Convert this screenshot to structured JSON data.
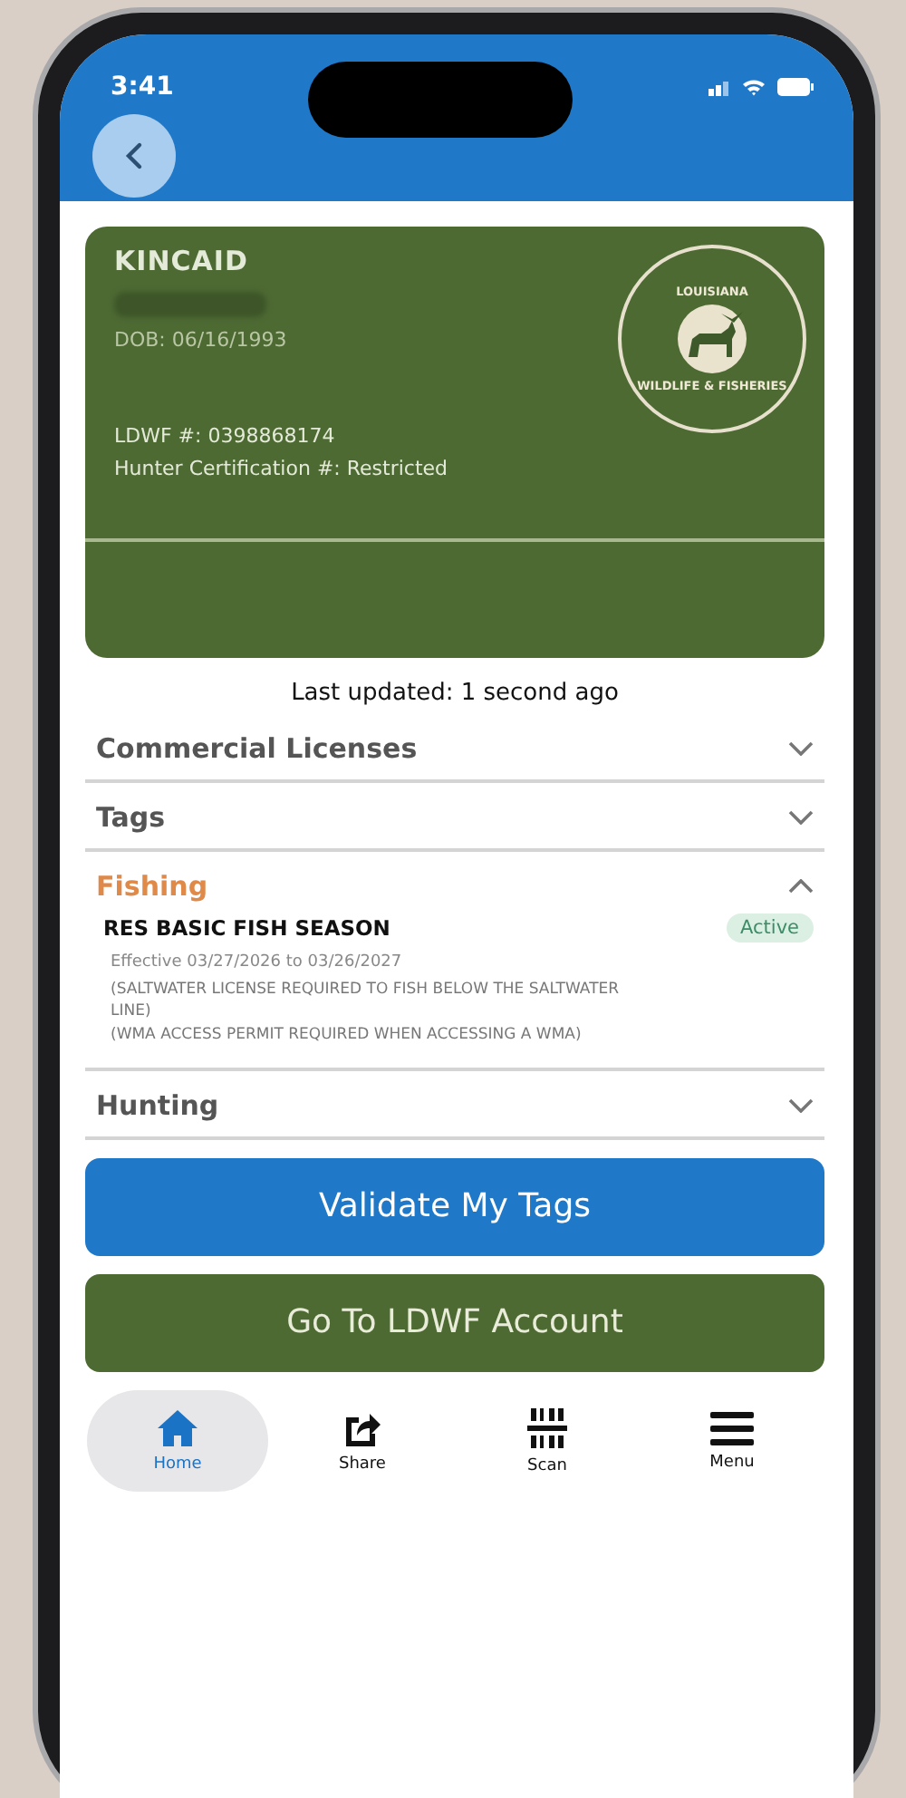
{
  "status_bar": {
    "time": "3:41"
  },
  "card": {
    "surname": "KINCAID",
    "dob": "DOB: 06/16/1993",
    "ldwf_number": "LDWF #: 0398868174",
    "hunter_certification": "Hunter Certification #: Restricted",
    "seal": {
      "top": "LOUISIANA",
      "bottom": "WILDLIFE & FISHERIES"
    }
  },
  "last_updated": "Last updated: 1 second ago",
  "sections": [
    {
      "title": "Commercial Licenses",
      "expanded": false
    },
    {
      "title": "Tags",
      "expanded": false
    },
    {
      "title": "Fishing",
      "expanded": true,
      "licenses": [
        {
          "name": "RES BASIC FISH SEASON",
          "status": "Active",
          "effective": "Effective 03/27/2026 to 03/26/2027",
          "notes": [
            "(SALTWATER LICENSE REQUIRED TO FISH BELOW THE SALTWATER LINE)",
            "(WMA ACCESS PERMIT REQUIRED WHEN ACCESSING A WMA)"
          ]
        }
      ]
    },
    {
      "title": "Hunting",
      "expanded": false
    }
  ],
  "buttons": [
    {
      "label": "Validate My Tags",
      "kind": "primary"
    },
    {
      "label": "Go To LDWF Account",
      "kind": "secondary"
    }
  ],
  "nav": [
    {
      "label": "Home",
      "kind": "home",
      "selected": true
    },
    {
      "label": "Share",
      "kind": "share",
      "selected": false
    },
    {
      "label": "Scan",
      "kind": "scan",
      "selected": false
    },
    {
      "label": "Menu",
      "kind": "menu",
      "selected": false
    }
  ]
}
